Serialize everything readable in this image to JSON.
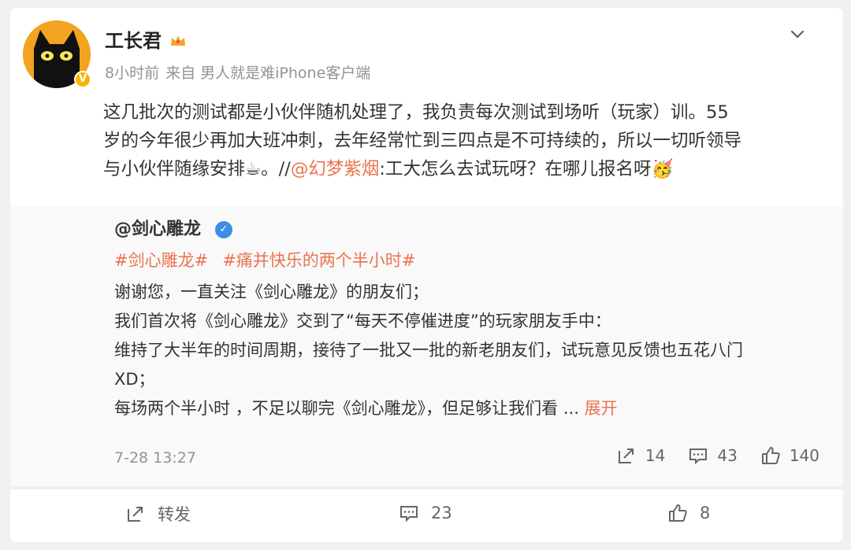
{
  "post": {
    "author": "工长君",
    "time": "8小时前",
    "source": "来自 男人就是难iPhone客户端",
    "text_line1": "这几批次的测试都是小伙伴随机处理了，我负责每次测试到场听（玩家）训。55",
    "text_line2": "岁的今年很少再加大班冲刺，去年经常忙到三四点是不可持续的，所以一切听领导",
    "text_line3_a": "与小伙伴随缘安排☕。//",
    "mention": "@幻梦紫烟",
    "text_line3_b": ":工大怎么去试玩呀？在哪儿报名呀🥳"
  },
  "quoted": {
    "author": "@剑心雕龙",
    "tags": [
      "#剑心雕龙#",
      "#痛并快乐的两个半小时#"
    ],
    "lines": [
      "谢谢您，一直关注《剑心雕龙》的朋友们；",
      " 我们首次将《剑心雕龙》交到了“每天不停催进度”的玩家朋友手中：",
      " 维持了大半年的时间周期，接待了一批又一批的新老朋友们，试玩意见反馈也五花八门",
      "XD；"
    ],
    "last_line": " 每场两个半小时 ，不足以聊完《剑心雕龙》，但足够让我们看  ... ",
    "expand_label": "展开",
    "date": "7-28 13:27",
    "reposts": "14",
    "comments": "43",
    "likes": "140"
  },
  "footer": {
    "repost_label": "转发",
    "comments": "23",
    "likes": "8"
  },
  "colors": {
    "accent": "#eb7350",
    "verified_blue": "#3d8ce6",
    "vip_yellow": "#f6b500"
  }
}
